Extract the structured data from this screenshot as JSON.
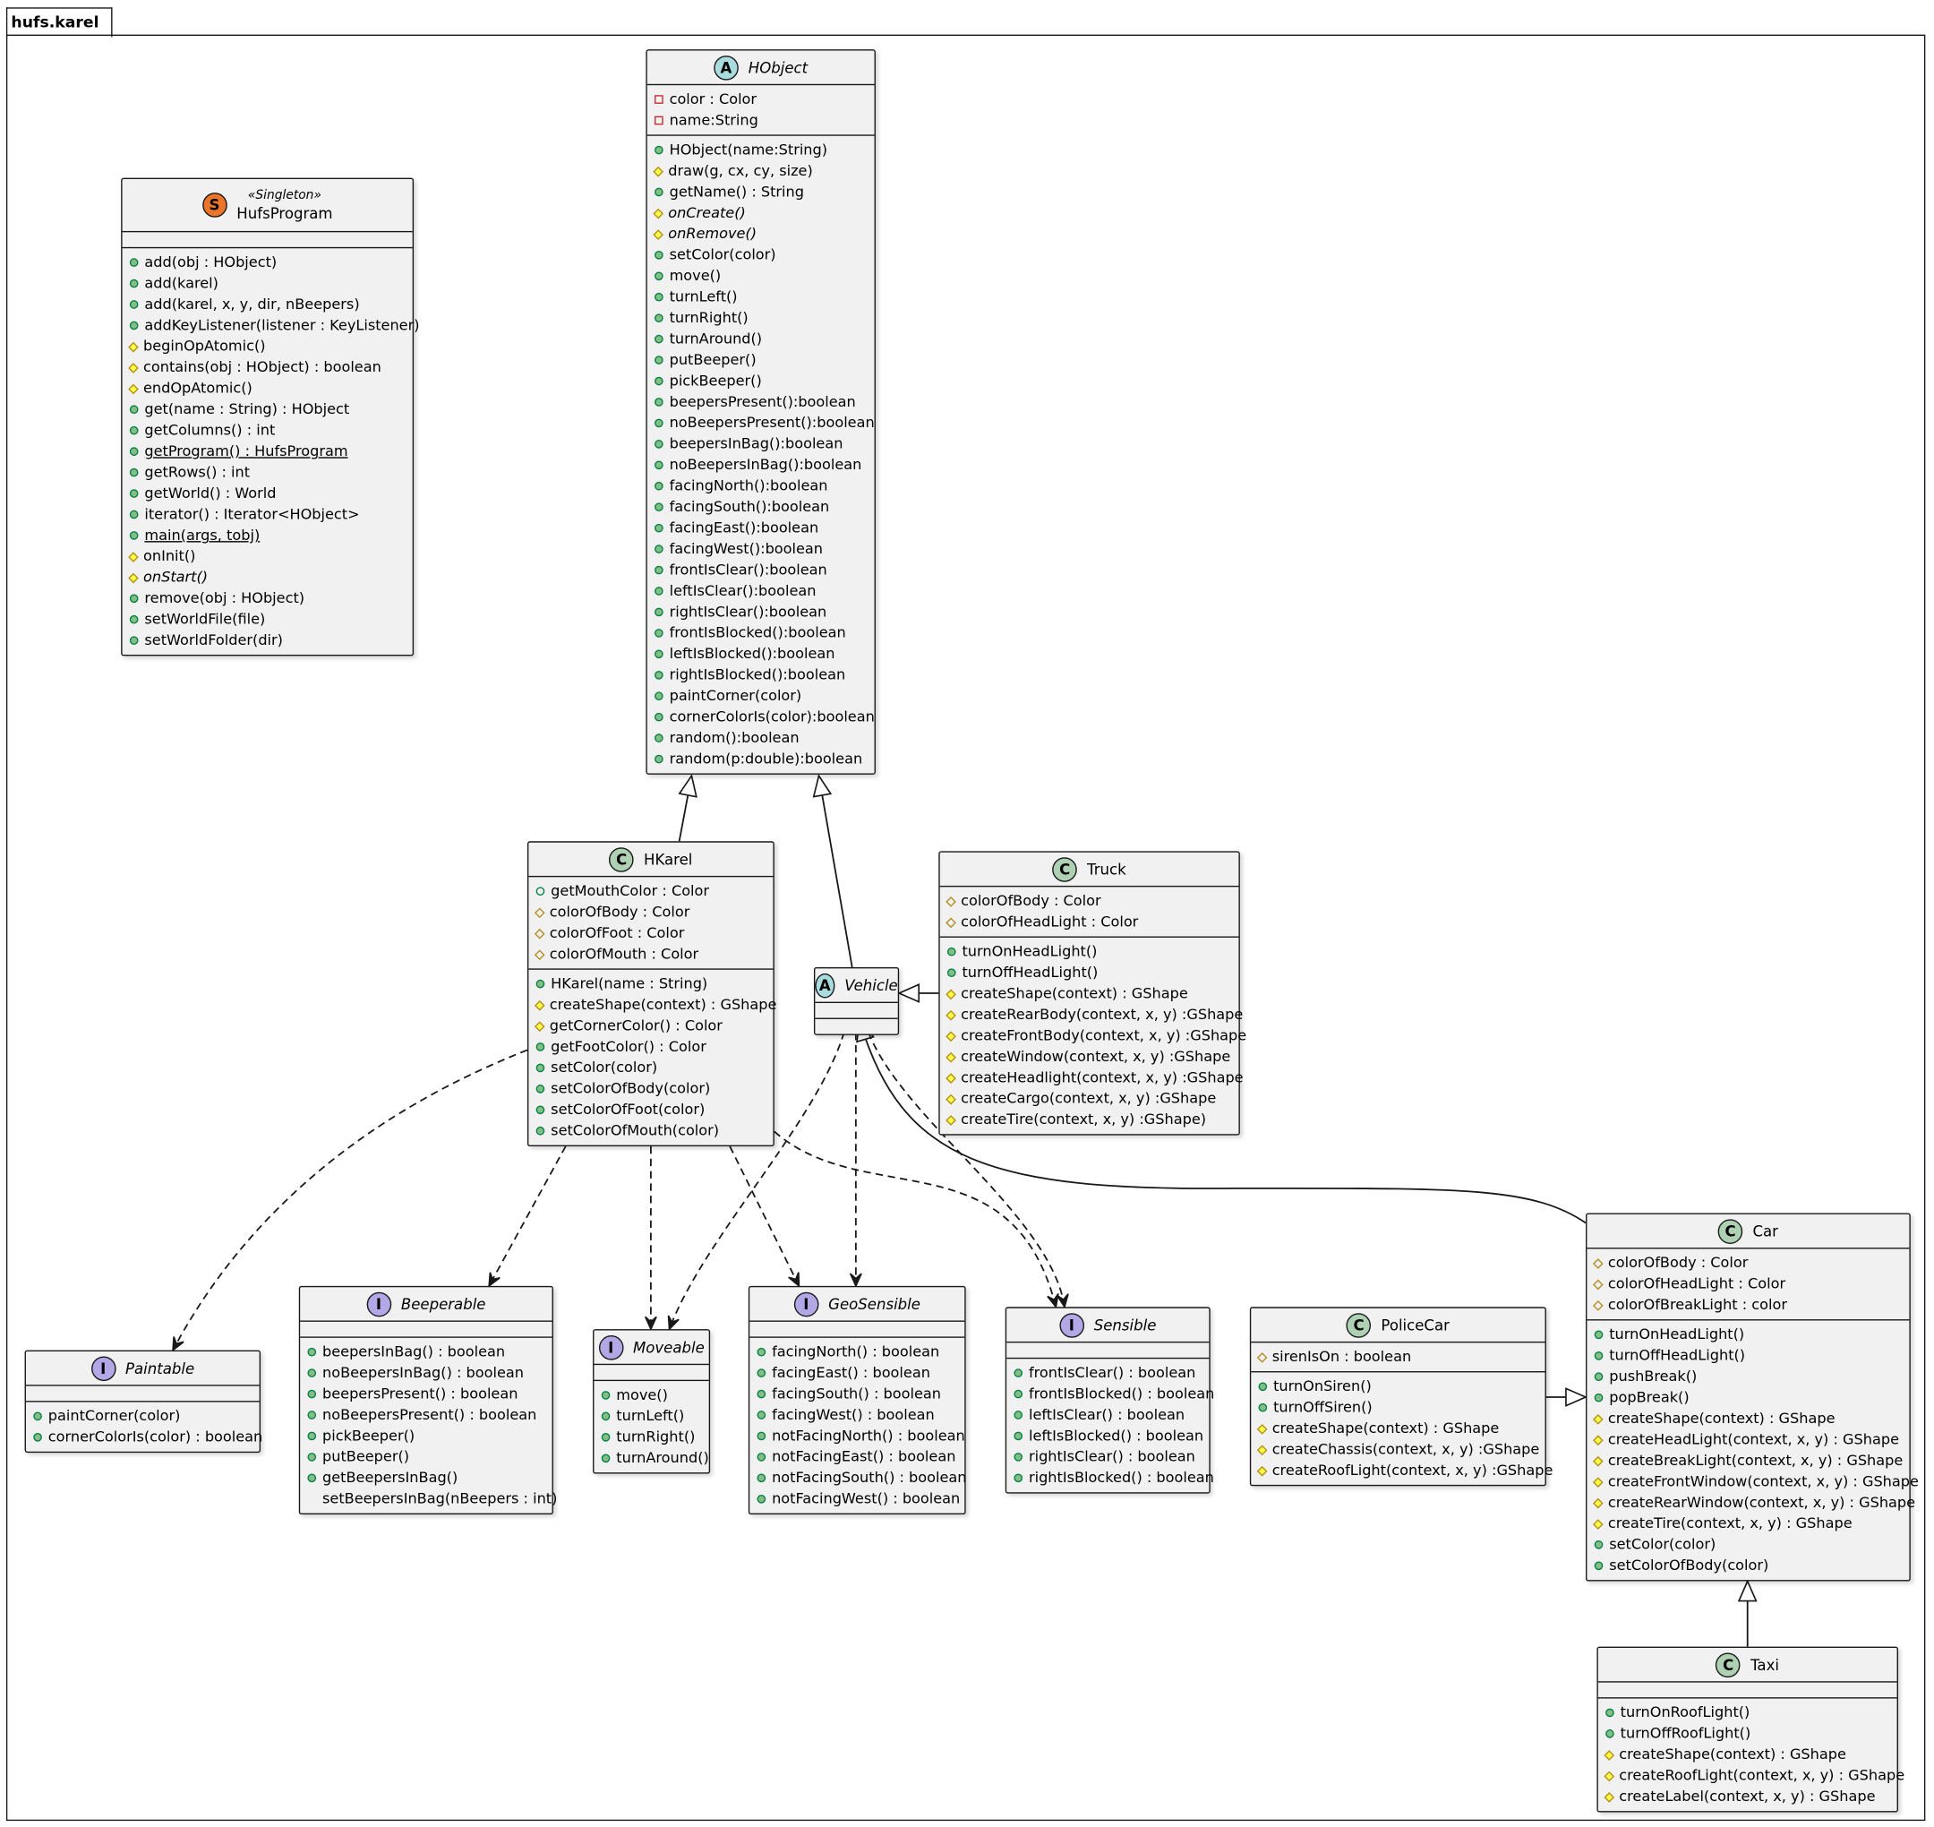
{
  "package": {
    "label": "hufs.karel"
  },
  "classes": {
    "hufsprogram": {
      "stereotype": "«Singleton»",
      "name": "HufsProgram",
      "kind": "S",
      "methods": [
        {
          "vis": "public",
          "text": "add(obj : HObject)"
        },
        {
          "vis": "public",
          "text": "add(karel)"
        },
        {
          "vis": "public",
          "text": "add(karel, x, y, dir, nBeepers)"
        },
        {
          "vis": "public",
          "text": "addKeyListener(listener : KeyListener)"
        },
        {
          "vis": "protected",
          "text": "beginOpAtomic()"
        },
        {
          "vis": "protected",
          "text": "contains(obj : HObject) : boolean"
        },
        {
          "vis": "protected",
          "text": "endOpAtomic()"
        },
        {
          "vis": "public",
          "text": "get(name : String) : HObject"
        },
        {
          "vis": "public",
          "text": "getColumns() : int"
        },
        {
          "vis": "public",
          "text": "getProgram() : HufsProgram",
          "style": "under"
        },
        {
          "vis": "public",
          "text": "getRows() : int"
        },
        {
          "vis": "public",
          "text": "getWorld() : World"
        },
        {
          "vis": "public",
          "text": "iterator() : Iterator<HObject>"
        },
        {
          "vis": "public",
          "text": "main(args, tobj)",
          "style": "under"
        },
        {
          "vis": "protected",
          "text": "onInit()"
        },
        {
          "vis": "protected",
          "text": "onStart()",
          "style": "italic"
        },
        {
          "vis": "public",
          "text": "remove(obj : HObject)"
        },
        {
          "vis": "public",
          "text": "setWorldFile(file)"
        },
        {
          "vis": "public",
          "text": "setWorldFolder(dir)"
        }
      ]
    },
    "hobject": {
      "name": "HObject",
      "kind": "A",
      "fields": [
        {
          "vis": "private",
          "text": "color : Color"
        },
        {
          "vis": "private",
          "text": "name:String"
        }
      ],
      "methods": [
        {
          "vis": "public",
          "text": "HObject(name:String)"
        },
        {
          "vis": "protected",
          "text": "draw(g, cx, cy, size)"
        },
        {
          "vis": "public",
          "text": "getName() : String"
        },
        {
          "vis": "protected",
          "text": "onCreate()",
          "style": "italic"
        },
        {
          "vis": "protected",
          "text": "onRemove()",
          "style": "italic"
        },
        {
          "vis": "public",
          "text": "setColor(color)"
        },
        {
          "vis": "public",
          "text": "move()"
        },
        {
          "vis": "public",
          "text": "turnLeft()"
        },
        {
          "vis": "public",
          "text": "turnRight()"
        },
        {
          "vis": "public",
          "text": "turnAround()"
        },
        {
          "vis": "public",
          "text": "putBeeper()"
        },
        {
          "vis": "public",
          "text": "pickBeeper()"
        },
        {
          "vis": "public",
          "text": "beepersPresent():boolean"
        },
        {
          "vis": "public",
          "text": "noBeepersPresent():boolean"
        },
        {
          "vis": "public",
          "text": "beepersInBag():boolean"
        },
        {
          "vis": "public",
          "text": "noBeepersInBag():boolean"
        },
        {
          "vis": "public",
          "text": "facingNorth():boolean"
        },
        {
          "vis": "public",
          "text": "facingSouth():boolean"
        },
        {
          "vis": "public",
          "text": "facingEast():boolean"
        },
        {
          "vis": "public",
          "text": "facingWest():boolean"
        },
        {
          "vis": "public",
          "text": "frontIsClear():boolean"
        },
        {
          "vis": "public",
          "text": "leftIsClear():boolean"
        },
        {
          "vis": "public",
          "text": "rightIsClear():boolean"
        },
        {
          "vis": "public",
          "text": "frontIsBlocked():boolean"
        },
        {
          "vis": "public",
          "text": "leftIsBlocked():boolean"
        },
        {
          "vis": "public",
          "text": "rightIsBlocked():boolean"
        },
        {
          "vis": "public",
          "text": "paintCorner(color)"
        },
        {
          "vis": "public",
          "text": "cornerColorIs(color):boolean"
        },
        {
          "vis": "public",
          "text": "random():boolean"
        },
        {
          "vis": "public",
          "text": "random(p:double):boolean"
        }
      ]
    },
    "hkarel": {
      "name": "HKarel",
      "kind": "C",
      "fields": [
        {
          "vis": "public-open",
          "text": "getMouthColor : Color"
        },
        {
          "vis": "protected-open",
          "text": "colorOfBody : Color"
        },
        {
          "vis": "protected-open",
          "text": "colorOfFoot : Color"
        },
        {
          "vis": "protected-open",
          "text": "colorOfMouth : Color"
        }
      ],
      "methods": [
        {
          "vis": "public",
          "text": "HKarel(name : String)"
        },
        {
          "vis": "protected",
          "text": "createShape(context) : GShape"
        },
        {
          "vis": "protected",
          "text": "getCornerColor() : Color"
        },
        {
          "vis": "public",
          "text": "getFootColor() : Color"
        },
        {
          "vis": "public",
          "text": "setColor(color)"
        },
        {
          "vis": "public",
          "text": "setColorOfBody(color)"
        },
        {
          "vis": "public",
          "text": "setColorOfFoot(color)"
        },
        {
          "vis": "public",
          "text": "setColorOfMouth(color)"
        }
      ]
    },
    "truck": {
      "name": "Truck",
      "kind": "C",
      "fields": [
        {
          "vis": "protected-open",
          "text": "colorOfBody : Color"
        },
        {
          "vis": "protected-open",
          "text": "colorOfHeadLight : Color"
        }
      ],
      "methods": [
        {
          "vis": "public",
          "text": "turnOnHeadLight()"
        },
        {
          "vis": "public",
          "text": "turnOffHeadLight()"
        },
        {
          "vis": "protected",
          "text": "createShape(context) : GShape"
        },
        {
          "vis": "protected",
          "text": "createRearBody(context, x, y) :GShape"
        },
        {
          "vis": "protected",
          "text": "createFrontBody(context, x, y) :GShape"
        },
        {
          "vis": "protected",
          "text": "createWindow(context, x, y) :GShape"
        },
        {
          "vis": "protected",
          "text": "createHeadlight(context, x, y) :GShape"
        },
        {
          "vis": "protected",
          "text": "createCargo(context, x, y) :GShape"
        },
        {
          "vis": "protected",
          "text": "createTire(context, x, y) :GShape)"
        }
      ]
    },
    "vehicle": {
      "name": "Vehicle",
      "kind": "A"
    },
    "car": {
      "name": "Car",
      "kind": "C",
      "fields": [
        {
          "vis": "protected-open",
          "text": "colorOfBody : Color"
        },
        {
          "vis": "protected-open",
          "text": "colorOfHeadLight : Color"
        },
        {
          "vis": "protected-open",
          "text": "colorOfBreakLight : color"
        }
      ],
      "methods": [
        {
          "vis": "public",
          "text": "turnOnHeadLight()"
        },
        {
          "vis": "public",
          "text": "turnOffHeadLight()"
        },
        {
          "vis": "public",
          "text": "pushBreak()"
        },
        {
          "vis": "public",
          "text": "popBreak()"
        },
        {
          "vis": "protected",
          "text": "createShape(context) : GShape"
        },
        {
          "vis": "protected",
          "text": "createHeadLight(context, x, y) : GShape"
        },
        {
          "vis": "protected",
          "text": "createBreakLight(context, x, y) : GShape"
        },
        {
          "vis": "protected",
          "text": "createFrontWindow(context, x, y) : GShape"
        },
        {
          "vis": "protected",
          "text": "createRearWindow(context, x, y) : GShape"
        },
        {
          "vis": "protected",
          "text": "createTire(context, x, y) : GShape"
        },
        {
          "vis": "public",
          "text": "setColor(color)"
        },
        {
          "vis": "public",
          "text": "setColorOfBody(color)"
        }
      ]
    },
    "policecar": {
      "name": "PoliceCar",
      "kind": "C",
      "fields": [
        {
          "vis": "protected-open",
          "text": "sirenIsOn : boolean"
        }
      ],
      "methods": [
        {
          "vis": "public",
          "text": "turnOnSiren()"
        },
        {
          "vis": "public",
          "text": "turnOffSiren()"
        },
        {
          "vis": "protected",
          "text": "createShape(context) : GShape"
        },
        {
          "vis": "protected",
          "text": "createChassis(context, x, y) :GShape"
        },
        {
          "vis": "protected",
          "text": "createRoofLight(context, x, y) :GShape"
        }
      ]
    },
    "taxi": {
      "name": "Taxi",
      "kind": "C",
      "methods": [
        {
          "vis": "public",
          "text": "turnOnRoofLight()"
        },
        {
          "vis": "public",
          "text": "turnOffRoofLight()"
        },
        {
          "vis": "protected",
          "text": "createShape(context) : GShape"
        },
        {
          "vis": "protected",
          "text": "createRoofLight(context, x, y) : GShape"
        },
        {
          "vis": "protected",
          "text": "createLabel(context, x, y) : GShape"
        }
      ]
    },
    "paintable": {
      "name": "Paintable",
      "kind": "I",
      "methods": [
        {
          "vis": "public",
          "text": "paintCorner(color)"
        },
        {
          "vis": "public",
          "text": "cornerColorIs(color) : boolean"
        }
      ]
    },
    "beeperable": {
      "name": "Beeperable",
      "kind": "I",
      "methods": [
        {
          "vis": "public",
          "text": "beepersInBag() : boolean"
        },
        {
          "vis": "public",
          "text": "noBeepersInBag() : boolean"
        },
        {
          "vis": "public",
          "text": "beepersPresent() : boolean"
        },
        {
          "vis": "public",
          "text": "noBeepersPresent() : boolean"
        },
        {
          "vis": "public",
          "text": "pickBeeper()"
        },
        {
          "vis": "public",
          "text": "putBeeper()"
        },
        {
          "vis": "public",
          "text": "getBeepersInBag()"
        },
        {
          "vis": "none",
          "text": "setBeepersInBag(nBeepers : int)"
        }
      ]
    },
    "moveable": {
      "name": "Moveable",
      "kind": "I",
      "methods": [
        {
          "vis": "public",
          "text": "move()"
        },
        {
          "vis": "public",
          "text": "turnLeft()"
        },
        {
          "vis": "public",
          "text": "turnRight()"
        },
        {
          "vis": "public",
          "text": "turnAround()"
        }
      ]
    },
    "geosensible": {
      "name": "GeoSensible",
      "kind": "I",
      "methods": [
        {
          "vis": "public",
          "text": "facingNorth() : boolean"
        },
        {
          "vis": "public",
          "text": "facingEast() : boolean"
        },
        {
          "vis": "public",
          "text": "facingSouth() : boolean"
        },
        {
          "vis": "public",
          "text": "facingWest() : boolean"
        },
        {
          "vis": "public",
          "text": "notFacingNorth() : boolean"
        },
        {
          "vis": "public",
          "text": "notFacingEast() : boolean"
        },
        {
          "vis": "public",
          "text": "notFacingSouth() : boolean"
        },
        {
          "vis": "public",
          "text": "notFacingWest() : boolean"
        }
      ]
    },
    "sensible": {
      "name": "Sensible",
      "kind": "I",
      "methods": [
        {
          "vis": "public",
          "text": "frontIsClear() : boolean"
        },
        {
          "vis": "public",
          "text": "frontIsBlocked() : boolean"
        },
        {
          "vis": "public",
          "text": "leftIsClear() : boolean"
        },
        {
          "vis": "public",
          "text": "leftIsBlocked() : boolean"
        },
        {
          "vis": "public",
          "text": "rightIsClear() : boolean"
        },
        {
          "vis": "public",
          "text": "rightIsBlocked() : boolean"
        }
      ]
    }
  },
  "relations": [
    {
      "from": "hkarel",
      "to": "hobject",
      "type": "extends"
    },
    {
      "from": "vehicle",
      "to": "hobject",
      "type": "extends"
    },
    {
      "from": "truck",
      "to": "vehicle",
      "type": "extends"
    },
    {
      "from": "car",
      "to": "vehicle",
      "type": "extends"
    },
    {
      "from": "policecar",
      "to": "car",
      "type": "extends"
    },
    {
      "from": "taxi",
      "to": "car",
      "type": "extends"
    },
    {
      "from": "hkarel",
      "to": "paintable",
      "type": "implements"
    },
    {
      "from": "hkarel",
      "to": "beeperable",
      "type": "implements"
    },
    {
      "from": "hkarel",
      "to": "moveable",
      "type": "implements"
    },
    {
      "from": "hkarel",
      "to": "geosensible",
      "type": "implements"
    },
    {
      "from": "hkarel",
      "to": "sensible",
      "type": "implements"
    },
    {
      "from": "vehicle",
      "to": "moveable",
      "type": "implements"
    },
    {
      "from": "vehicle",
      "to": "geosensible",
      "type": "implements"
    },
    {
      "from": "vehicle",
      "to": "sensible",
      "type": "implements"
    }
  ]
}
